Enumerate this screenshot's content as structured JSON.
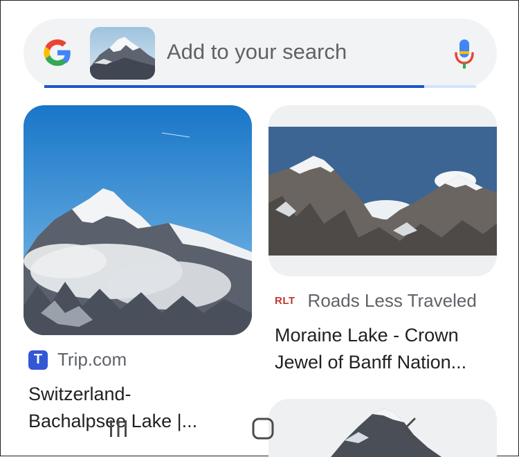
{
  "search": {
    "placeholder": "Add to your search",
    "logo_icon": "google-g-icon",
    "mic_icon": "microphone-icon",
    "progress": 0.88
  },
  "results": [
    {
      "source": "Trip.com",
      "source_icon": "trip-com-icon",
      "title_line1": "Switzerland-",
      "title_line2": "Bachalpsee Lake |..."
    },
    {
      "source": "Roads Less Traveled",
      "source_icon_text": "RLT",
      "title_line1": "Moraine Lake - Crown",
      "title_line2": "Jewel of Banff Nation..."
    }
  ],
  "nav": {
    "recents_icon": "recents-icon",
    "home_icon": "home-icon",
    "back_icon": "back-icon"
  },
  "colors": {
    "accent": "#1a57c8",
    "search_bg": "#f1f3f4",
    "trip_brand": "#3457d5",
    "rlt_brand": "#c4372a"
  }
}
